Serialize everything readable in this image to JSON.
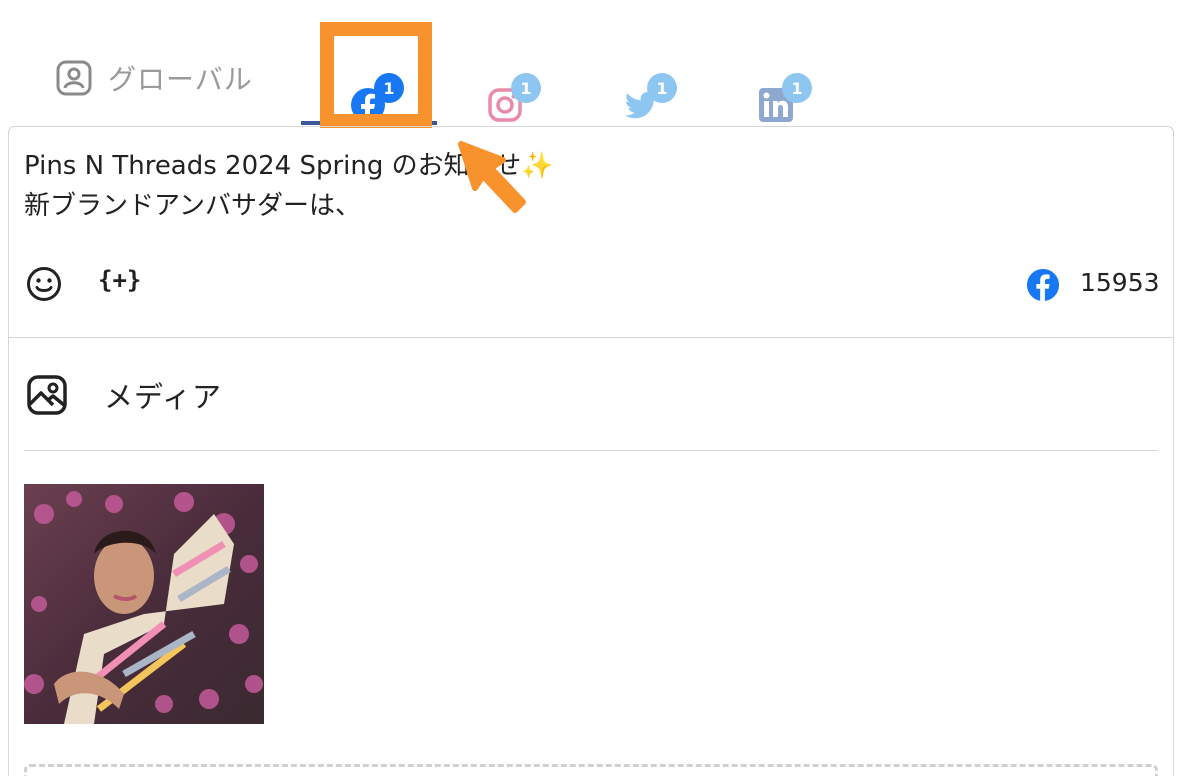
{
  "tabs": {
    "global": {
      "label": "グローバル",
      "icon": "user-card-icon"
    },
    "facebook": {
      "badge": "1",
      "icon": "facebook-icon",
      "color": "#1877f2",
      "active": true
    },
    "instagram": {
      "badge": "1",
      "icon": "instagram-icon",
      "color": "#e98aa8"
    },
    "twitter": {
      "badge": "1",
      "icon": "twitter-icon",
      "color": "#8ec6f2"
    },
    "linkedin": {
      "badge": "1",
      "icon": "linkedin-icon",
      "color": "#8fa8cf"
    },
    "badge_active_color": "#1877f2",
    "badge_inactive_color": "#8ec6f2"
  },
  "highlight_color": "#f7922c",
  "editor": {
    "line1": "Pins N Threads 2024 Spring のお知らせ",
    "line1_emoji": "✨",
    "line2": "新ブランドアンバサダーは、",
    "variable_button": "{+}",
    "char_count": "15953",
    "emoji_icon": "smiley-icon"
  },
  "media": {
    "label": "メディア",
    "icon": "image-icon"
  }
}
